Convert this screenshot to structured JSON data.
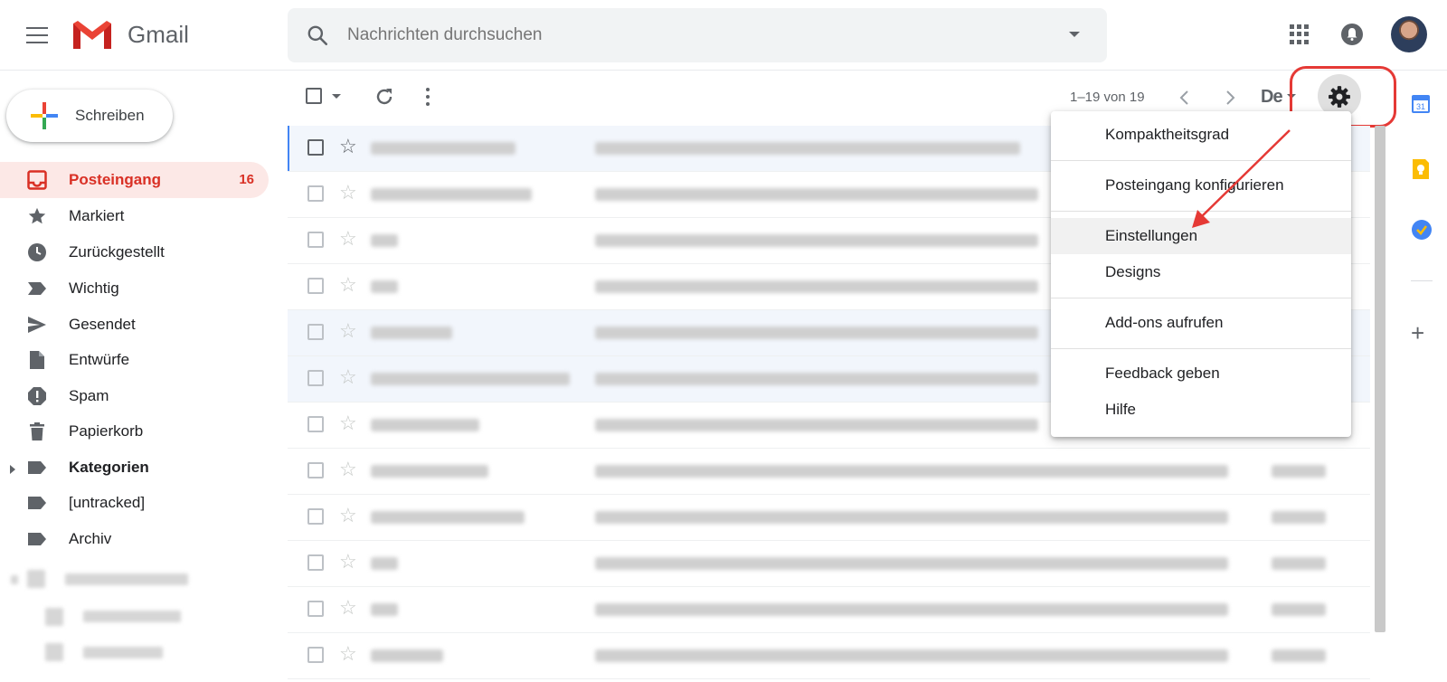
{
  "app": {
    "name": "Gmail"
  },
  "search": {
    "placeholder": "Nachrichten durchsuchen"
  },
  "compose": {
    "label": "Schreiben"
  },
  "sidebar": {
    "items": [
      {
        "label": "Posteingang",
        "count": "16",
        "icon": "inbox-icon",
        "active": true
      },
      {
        "label": "Markiert",
        "icon": "star-icon"
      },
      {
        "label": "Zurückgestellt",
        "icon": "clock-icon"
      },
      {
        "label": "Wichtig",
        "icon": "label-important-icon"
      },
      {
        "label": "Gesendet",
        "icon": "send-icon"
      },
      {
        "label": "Entwürfe",
        "icon": "draft-icon"
      },
      {
        "label": "Spam",
        "icon": "spam-icon"
      },
      {
        "label": "Papierkorb",
        "icon": "trash-icon"
      },
      {
        "label": "Kategorien",
        "icon": "label-icon"
      },
      {
        "label": "[untracked]",
        "icon": "label-icon"
      },
      {
        "label": "Archiv",
        "icon": "label-icon"
      }
    ]
  },
  "toolbar": {
    "page_info": "1–19 von 19",
    "language": "De"
  },
  "settings_menu": {
    "items": [
      "Kompaktheitsgrad",
      "Posteingang konfigurieren",
      "Einstellungen",
      "Designs",
      "Add-ons aufrufen",
      "Feedback geben",
      "Hilfe"
    ],
    "highlighted": "Einstellungen"
  },
  "colors": {
    "accent_red": "#d93025",
    "highlight_red": "#e53935",
    "active_bg": "#fce8e6",
    "search_bg": "#f1f3f4"
  }
}
